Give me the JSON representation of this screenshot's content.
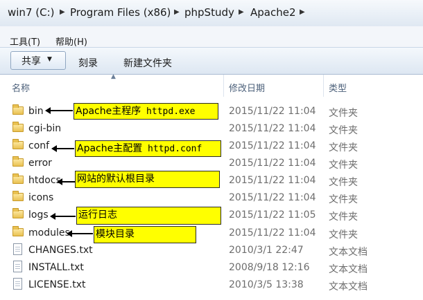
{
  "breadcrumb": {
    "items": [
      {
        "label": "win7 (C:)"
      },
      {
        "label": "Program Files (x86)"
      },
      {
        "label": "phpStudy"
      },
      {
        "label": "Apache2"
      }
    ]
  },
  "menu": {
    "tools": "工具(T)",
    "help": "帮助(H)"
  },
  "toolbar": {
    "share": "共享",
    "burn": "刻录",
    "new_folder": "新建文件夹"
  },
  "columns": {
    "name": "名称",
    "modified": "修改日期",
    "type": "类型"
  },
  "rows": [
    {
      "name": "bin",
      "date": "2015/11/22 11:04",
      "type": "文件夹",
      "icon": "folder-icon"
    },
    {
      "name": "cgi-bin",
      "date": "2015/11/22 11:04",
      "type": "文件夹",
      "icon": "folder-icon"
    },
    {
      "name": "conf",
      "date": "2015/11/22 11:04",
      "type": "文件夹",
      "icon": "folder-icon"
    },
    {
      "name": "error",
      "date": "2015/11/22 11:04",
      "type": "文件夹",
      "icon": "folder-icon"
    },
    {
      "name": "htdocs",
      "date": "2015/11/22 11:04",
      "type": "文件夹",
      "icon": "folder-icon"
    },
    {
      "name": "icons",
      "date": "2015/11/22 11:04",
      "type": "文件夹",
      "icon": "folder-icon"
    },
    {
      "name": "logs",
      "date": "2015/11/22 11:05",
      "type": "文件夹",
      "icon": "folder-icon"
    },
    {
      "name": "modules",
      "date": "2015/11/22 11:04",
      "type": "文件夹",
      "icon": "folder-icon"
    },
    {
      "name": "CHANGES.txt",
      "date": "2010/3/1 22:47",
      "type": "文本文档",
      "icon": "text-file-icon"
    },
    {
      "name": "INSTALL.txt",
      "date": "2008/9/18 12:16",
      "type": "文本文档",
      "icon": "text-file-icon"
    },
    {
      "name": "LICENSE.txt",
      "date": "2010/3/5 13:38",
      "type": "文本文档",
      "icon": "text-file-icon"
    }
  ],
  "annotations": [
    {
      "prefix": "Apache主程序",
      "mono": " httpd.exe"
    },
    {
      "prefix": "Apache主配置",
      "mono": " httpd.conf"
    },
    {
      "prefix": "网站的默认根目录",
      "mono": ""
    },
    {
      "prefix": "运行日志",
      "mono": ""
    },
    {
      "prefix": "模块目录",
      "mono": ""
    }
  ],
  "colors": {
    "highlight": "#ffff00",
    "column_header_text": "#4c607a",
    "secondary_text": "#6d6d6d"
  }
}
